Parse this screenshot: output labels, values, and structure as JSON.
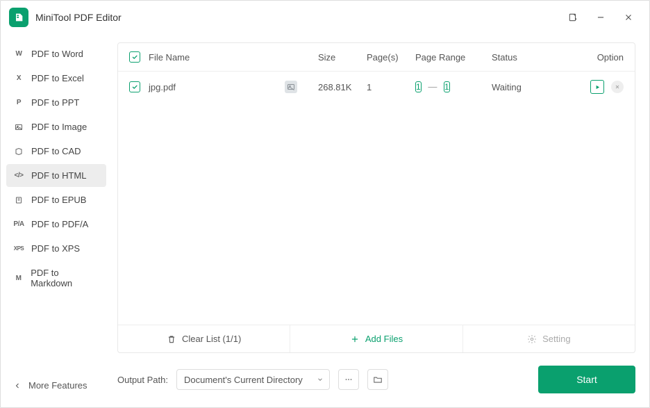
{
  "window": {
    "title": "MiniTool PDF Editor"
  },
  "sidebar": {
    "items": [
      {
        "icon": "W",
        "label": "PDF to Word"
      },
      {
        "icon": "X",
        "label": "PDF to Excel"
      },
      {
        "icon": "P",
        "label": "PDF to PPT"
      },
      {
        "icon": "img",
        "label": "PDF to Image"
      },
      {
        "icon": "cad",
        "label": "PDF to CAD"
      },
      {
        "icon": "</>",
        "label": "PDF to HTML",
        "active": true
      },
      {
        "icon": "epub",
        "label": "PDF to EPUB"
      },
      {
        "icon": "P/A",
        "label": "PDF to PDF/A"
      },
      {
        "icon": "XPS",
        "label": "PDF to XPS"
      },
      {
        "icon": "M",
        "label": "PDF to Markdown"
      }
    ],
    "more": "More Features"
  },
  "table": {
    "headers": {
      "file_name": "File Name",
      "size": "Size",
      "pages": "Page(s)",
      "page_range": "Page Range",
      "status": "Status",
      "option": "Option"
    },
    "rows": [
      {
        "name": "jpg.pdf",
        "size": "268.81K",
        "pages": "1",
        "range_from": "1",
        "range_to": "1",
        "status": "Waiting"
      }
    ]
  },
  "footer": {
    "clear_list": "Clear List (1/1)",
    "add_files": "Add Files",
    "setting": "Setting"
  },
  "output": {
    "label": "Output Path:",
    "value": "Document's Current Directory"
  },
  "start": "Start",
  "colors": {
    "accent": "#0aa06e"
  }
}
